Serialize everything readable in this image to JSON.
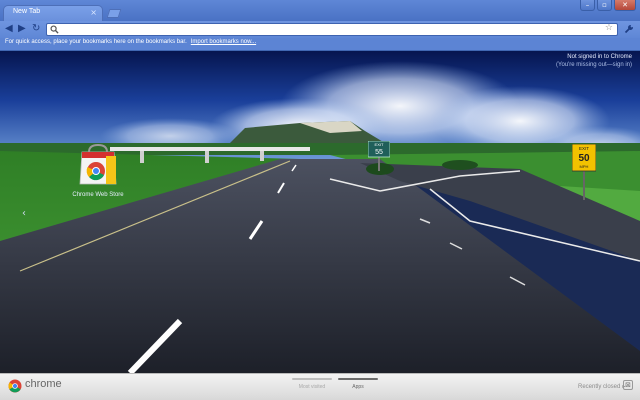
{
  "window": {
    "tab_title": "New Tab",
    "tab_close_glyph": "×",
    "controls": [
      "–",
      "▫",
      "✕"
    ]
  },
  "toolbar": {
    "back_glyph": "◀",
    "forward_glyph": "▶",
    "reload_glyph": "↻",
    "omnibox_value": "",
    "omnibox_icon": "search-icon",
    "star_glyph": "☆",
    "wrench_glyph": "🔧"
  },
  "bookmarks_bar": {
    "prompt": "For quick access, place your bookmarks here on the bookmarks bar.",
    "import_link": "Import bookmarks now..."
  },
  "content": {
    "signin_status": "Not signed in to Chrome",
    "signin_link": "(You're missing out—sign in)",
    "apps": [
      {
        "label": "Chrome Web Store",
        "icon": "chrome-web-store-icon"
      }
    ],
    "scene": {
      "exit_sign_header": "EXIT",
      "exit_sign_number": "55",
      "speed_sign_label": "EXIT",
      "speed_sign_number": "50",
      "speed_sign_unit": "MPH"
    }
  },
  "bottom_bar": {
    "logo_text": "chrome",
    "pages": [
      {
        "label": "Most visited",
        "active": false
      },
      {
        "label": "Apps",
        "active": true
      }
    ],
    "recently_closed": "Recently closed",
    "recently_closed_arrow": "▸"
  },
  "colors": {
    "frame_blue": "#5f87d6",
    "sky_deep": "#0a1a60",
    "grass": "#3f9a2c",
    "road": "#2b2f3a",
    "sign_green": "#1f5f5a",
    "sign_yellow": "#f2c200"
  }
}
